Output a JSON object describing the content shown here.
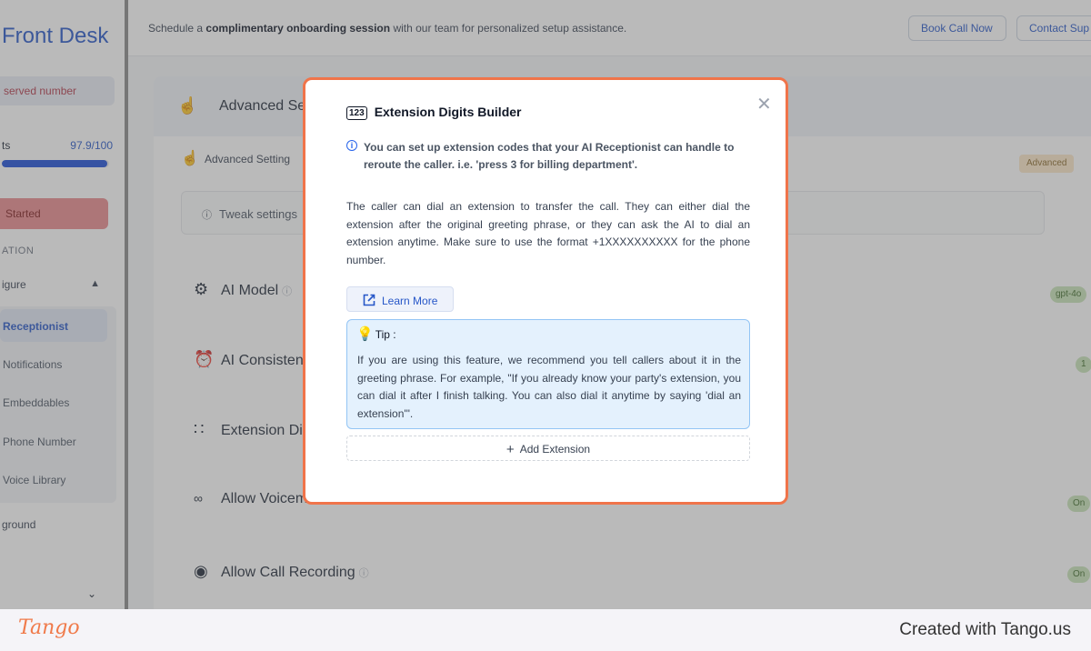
{
  "sidebar": {
    "logo": "Front Desk",
    "reserved_number": "served number",
    "credits_label": "ts",
    "credits_value": "97.9/100",
    "credits_fraction": 0.979,
    "get_started": "Started",
    "section_label": "ATION",
    "configure_label": "igure",
    "items": [
      {
        "label": "Receptionist",
        "active": true
      },
      {
        "label": "Notifications",
        "active": false
      },
      {
        "label": "Embeddables",
        "active": false
      },
      {
        "label": "Phone Number",
        "active": false
      },
      {
        "label": "Voice Library",
        "active": false
      }
    ],
    "playground": "ground"
  },
  "banner": {
    "text_before": "Schedule a ",
    "text_bold": "complimentary onboarding session",
    "text_after": " with our team for personalized setup assistance.",
    "book_call": "Book Call Now",
    "contact": "Contact Sup"
  },
  "main": {
    "header_title": "Advanced Se",
    "advanced_row": "Advanced Setting",
    "advanced_badge": "Advanced",
    "tweak_text": "Tweak settings",
    "settings": [
      {
        "label": "AI Model",
        "pill": "gpt-4o",
        "icon": "robot-icon"
      },
      {
        "label": "AI Consistenc",
        "pill": "1",
        "icon": "alarm-clock-icon"
      },
      {
        "label": "Extension Dig",
        "pill": "",
        "icon": "dialpad-icon"
      },
      {
        "label": "Allow Voicem",
        "pill": "On",
        "icon": "voicemail-icon"
      },
      {
        "label": "Allow Call Recording",
        "pill": "On",
        "icon": "record-icon"
      }
    ]
  },
  "modal": {
    "badge": "123",
    "title": "Extension Digits Builder",
    "info_note": "You can set up extension codes that your AI Receptionist can handle to reroute the caller. i.e. 'press 3 for billing department'.",
    "description": "The caller can dial an extension to transfer the call. They can either dial the extension after the original greeting phrase, or they can ask the AI to dial an extension anytime. Make sure to use the format +1XXXXXXXXXX for the phone number.",
    "learn_more": "Learn More",
    "tip_label": "Tip :",
    "tip_body": "If you are using this feature, we recommend you tell callers about it in the greeting phrase. For example, \"If you already know your party's extension, you can dial it after I finish talking. You can also dial it anytime by saying 'dial an extension'\".",
    "add_extension": "Add Extension"
  },
  "footer": {
    "brand": "Tango",
    "created": "Created with Tango.us"
  },
  "colors": {
    "accent": "#2757c8",
    "modal_border": "#f0744a",
    "tip_bg": "#e4f1fd",
    "brand_orange": "#f07a4a"
  }
}
